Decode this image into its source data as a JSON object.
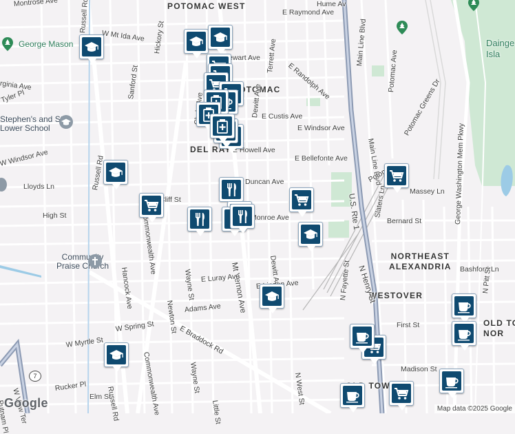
{
  "neighborhoods": [
    {
      "id": "potomac-west",
      "text": "POTOMAC WEST"
    },
    {
      "id": "potomac",
      "text": "POTOMAC"
    },
    {
      "id": "del-ray",
      "text": "DEL RAY"
    },
    {
      "id": "northeast-alexandria",
      "text": "NORTHEAST\nALEXANDRIA"
    },
    {
      "id": "westover",
      "text": "WESTOVER"
    },
    {
      "id": "old-town",
      "text": "OLD TOWN"
    },
    {
      "id": "old-town-north",
      "text": "OLD TO\nNOR"
    },
    {
      "id": "daingerfield",
      "text": "Dainge\nIsla"
    }
  ],
  "streets": [
    {
      "id": "e-raymond-ave",
      "text": "E Raymond Ave"
    },
    {
      "id": "w-mt-ida-ave",
      "text": "W Mt Ida Ave"
    },
    {
      "id": "hickory-st",
      "text": "Hickory St"
    },
    {
      "id": "russell-rd-n",
      "text": "Russell Rd"
    },
    {
      "id": "terrett-ave",
      "text": "Terrett Ave"
    },
    {
      "id": "e-randolph-ave",
      "text": "E Randolph Ave"
    },
    {
      "id": "main-line-blvd-n",
      "text": "Main Line Blvd"
    },
    {
      "id": "potomac-ave-n",
      "text": "Potomac Ave"
    },
    {
      "id": "virginia-ave",
      "text": "rginia Ave"
    },
    {
      "id": "sanford-st",
      "text": "Sanford St"
    },
    {
      "id": "stewart-ave",
      "text": "ewart Ave"
    },
    {
      "id": "tyler-pl",
      "text": "Tyler Pl"
    },
    {
      "id": "dewitt-ave-n",
      "text": "Dewitt Ave"
    },
    {
      "id": "e-custis-ave",
      "text": "E Custis Ave"
    },
    {
      "id": "clyde-ave",
      "text": "Clyde Ave"
    },
    {
      "id": "e-windsor-ave",
      "text": "E Windsor Ave"
    },
    {
      "id": "main-line-blvd-s",
      "text": "Main Line Blvd"
    },
    {
      "id": "gw-pkwy",
      "text": "George Washington Mem Pkwy"
    },
    {
      "id": "potomac-greens-dr",
      "text": "Potomac Greens Dr"
    },
    {
      "id": "w-windsor-ave",
      "text": "W Windsor Ave"
    },
    {
      "id": "e-howell-ave",
      "text": "E Howell Ave"
    },
    {
      "id": "e-bellefonte-ave",
      "text": "E Bellefonte Ave"
    },
    {
      "id": "us-rte-1",
      "text": "U.S. Rte 1"
    },
    {
      "id": "potomac-ave-s",
      "text": "Potoma"
    },
    {
      "id": "lloyds-ln",
      "text": "Lloyds Ln"
    },
    {
      "id": "russell-rd-mid",
      "text": "Russell Rd"
    },
    {
      "id": "commonwealth-ave-n",
      "text": "Commonwealth Ave"
    },
    {
      "id": "duncan-ave",
      "text": "Duncan Ave"
    },
    {
      "id": "cliff-st",
      "text": "Cliff St"
    },
    {
      "id": "massey-ln",
      "text": "Massey Ln"
    },
    {
      "id": "high-st",
      "text": "High St"
    },
    {
      "id": "slaters-ln",
      "text": "Slaters Ln"
    },
    {
      "id": "monroe-ave",
      "text": "Monroe Ave"
    },
    {
      "id": "bernard-st",
      "text": "Bernard St"
    },
    {
      "id": "mt-vernon-ave",
      "text": "Mt Vernon Ave"
    },
    {
      "id": "hancock-ave",
      "text": "Hancock Ave"
    },
    {
      "id": "wayne-st-n",
      "text": "Wayne St"
    },
    {
      "id": "dewitt-ave-s",
      "text": "Dewitt Ave"
    },
    {
      "id": "n-henry-st",
      "text": "N Henry St"
    },
    {
      "id": "bashford-ln",
      "text": "Bashford Ln"
    },
    {
      "id": "e-luray-ave",
      "text": "E Luray Ave"
    },
    {
      "id": "e-linden-ave",
      "text": "E Linden Ave"
    },
    {
      "id": "newton-st",
      "text": "Newton St"
    },
    {
      "id": "n-fayette-st",
      "text": "N Fayette St"
    },
    {
      "id": "n-pitt-st",
      "text": "N Pitt St"
    },
    {
      "id": "adams-ave",
      "text": "Adams Ave"
    },
    {
      "id": "e-braddock-rd",
      "text": "E Braddock Rd"
    },
    {
      "id": "w-spring-st",
      "text": "W Spring St"
    },
    {
      "id": "first-st",
      "text": "First St"
    },
    {
      "id": "commonwealth-ave-s",
      "text": "Commonwealth Ave"
    },
    {
      "id": "w-myrtle-st",
      "text": "W Myrtle St"
    },
    {
      "id": "russell-rd-s",
      "text": "Russell Rd"
    },
    {
      "id": "wayne-st-s",
      "text": "Wayne St"
    },
    {
      "id": "madison-st",
      "text": "Madison St"
    },
    {
      "id": "n-west-st",
      "text": "N West St"
    },
    {
      "id": "w-view-ter",
      "text": "W View Ter"
    },
    {
      "id": "rucker-pl",
      "text": "Rucker Pl"
    },
    {
      "id": "elm-st",
      "text": "Elm St"
    },
    {
      "id": "little-st",
      "text": "Little St"
    },
    {
      "id": "putnam-pl",
      "text": "Putnam Pl"
    },
    {
      "id": "montrose-ave",
      "text": "Montrose Ave"
    },
    {
      "id": "hume-ave",
      "text": "Hume Av"
    }
  ],
  "shields": [
    {
      "id": "va-7",
      "text": "7"
    }
  ],
  "pois": [
    {
      "id": "george-mason",
      "text": "George Mason",
      "color": "#2e7d5b"
    },
    {
      "id": "st-stephens",
      "text": "Stephen's and St.\nLower School",
      "color": "#3b4a5a"
    },
    {
      "id": "community-praise",
      "text": "Community\nPraise Church",
      "color": "#3b4a5a"
    }
  ],
  "markers": [
    {
      "type": "school"
    },
    {
      "type": "school"
    },
    {
      "type": "school"
    },
    {
      "type": "school"
    },
    {
      "type": "school"
    },
    {
      "type": "school"
    },
    {
      "type": "school"
    },
    {
      "type": "grocery"
    },
    {
      "type": "grocery"
    },
    {
      "type": "grocery"
    },
    {
      "type": "grocery"
    },
    {
      "type": "grocery"
    },
    {
      "type": "grocery"
    },
    {
      "type": "grocery"
    },
    {
      "type": "grocery"
    },
    {
      "type": "grocery"
    },
    {
      "type": "restaurant"
    },
    {
      "type": "restaurant"
    },
    {
      "type": "restaurant"
    },
    {
      "type": "restaurant"
    },
    {
      "type": "restaurant"
    },
    {
      "type": "restaurant"
    },
    {
      "type": "restaurant"
    },
    {
      "type": "cafe"
    },
    {
      "type": "cafe"
    },
    {
      "type": "cafe"
    },
    {
      "type": "cafe"
    },
    {
      "type": "cafe"
    },
    {
      "type": "cafe"
    },
    {
      "type": "pharmacy"
    },
    {
      "type": "pharmacy"
    },
    {
      "type": "pharmacy"
    }
  ],
  "colors": {
    "background": "#f4f2f4",
    "park": "#cfe8d4",
    "water": "#9ccbe6",
    "highway": "#8a9bb5",
    "rail": "#b8b8b8",
    "marker_fill": "#0f4a70"
  },
  "icons": {
    "school": "graduation-cap-icon",
    "grocery": "shopping-cart-icon",
    "restaurant": "fork-knife-icon",
    "cafe": "coffee-cup-icon",
    "pharmacy": "pharmacy-icon",
    "park": "tree-pin-icon",
    "church": "cross-icon"
  },
  "branding": {
    "logo": "Google",
    "attribution": "Map data ©2025 Google"
  }
}
